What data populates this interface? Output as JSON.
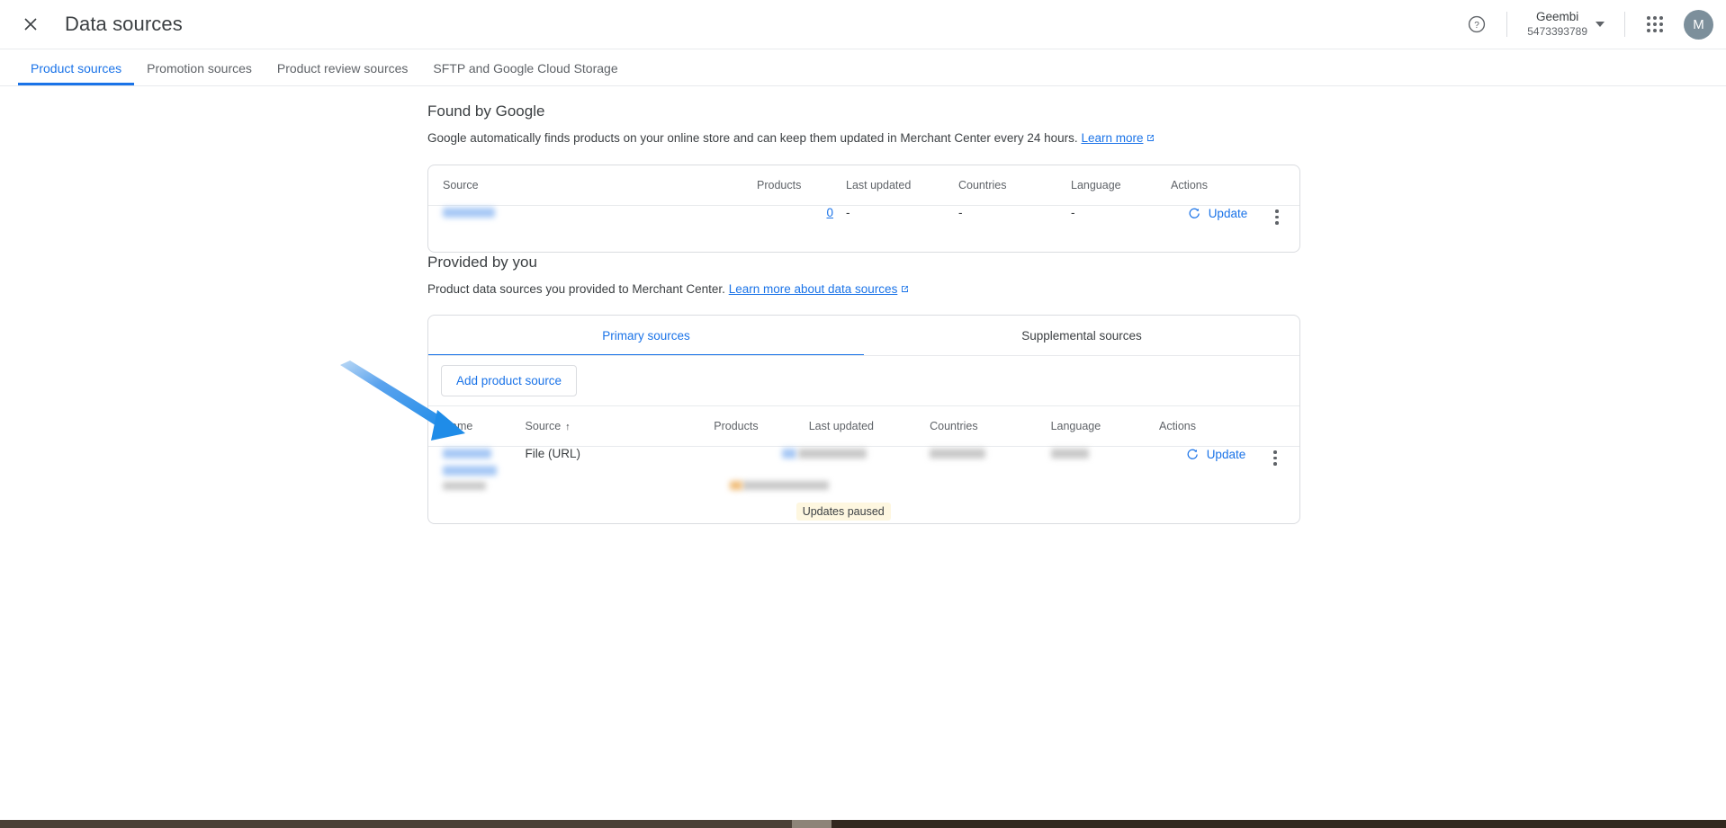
{
  "header": {
    "close_icon": "close-icon",
    "title": "Data sources",
    "help_icon": "help-circle-icon",
    "account_name": "Geembi",
    "account_id": "5473393789",
    "apps_icon": "apps-grid-icon",
    "avatar_initial": "M"
  },
  "main_tabs": [
    {
      "label": "Product sources",
      "active": true
    },
    {
      "label": "Promotion sources",
      "active": false
    },
    {
      "label": "Product review sources",
      "active": false
    },
    {
      "label": "SFTP and Google Cloud Storage",
      "active": false
    }
  ],
  "found_by_google": {
    "title": "Found by Google",
    "description": "Google automatically finds products on your online store and can keep them updated in Merchant Center every 24 hours.",
    "link_label": "Learn more",
    "columns": [
      "Source",
      "Products",
      "Last updated",
      "Countries",
      "Language",
      "Actions"
    ],
    "row": {
      "source": "[redacted]",
      "products": "0",
      "last_updated": "-",
      "countries": "-",
      "language": "-",
      "update_label": "Update",
      "menu_icon": "kebab-menu-icon"
    }
  },
  "provided_by_you": {
    "title": "Provided by you",
    "description": "Product data sources you provided to Merchant Center.",
    "link_label": "Learn more about data sources",
    "tabs": [
      {
        "label": "Primary sources",
        "active": true
      },
      {
        "label": "Supplemental sources",
        "active": false
      }
    ],
    "add_button_label": "Add product source",
    "columns": [
      "Name",
      "Source",
      "Products",
      "Last updated",
      "Countries",
      "Language",
      "Actions"
    ],
    "sorted_column": "Source",
    "sort_direction": "ascending",
    "row": {
      "name": "[redacted]",
      "source": "File (URL)",
      "products": "[redacted]",
      "last_updated": "[redacted]",
      "countries": "[redacted]",
      "language": "[redacted]",
      "status_badge": "Updates paused",
      "update_label": "Update",
      "menu_icon": "kebab-menu-icon"
    }
  },
  "annotation": {
    "type": "arrow",
    "color": "#1f8ce8",
    "points_to": "add-product-source-button"
  },
  "colors": {
    "accent": "#1a73e8",
    "text_primary": "#3c4043",
    "text_secondary": "#5f6368",
    "border": "#dadce0",
    "badge_bg": "#fef7e0",
    "avatar_bg": "#7c8f9b",
    "taskbar": "#3b3129"
  }
}
